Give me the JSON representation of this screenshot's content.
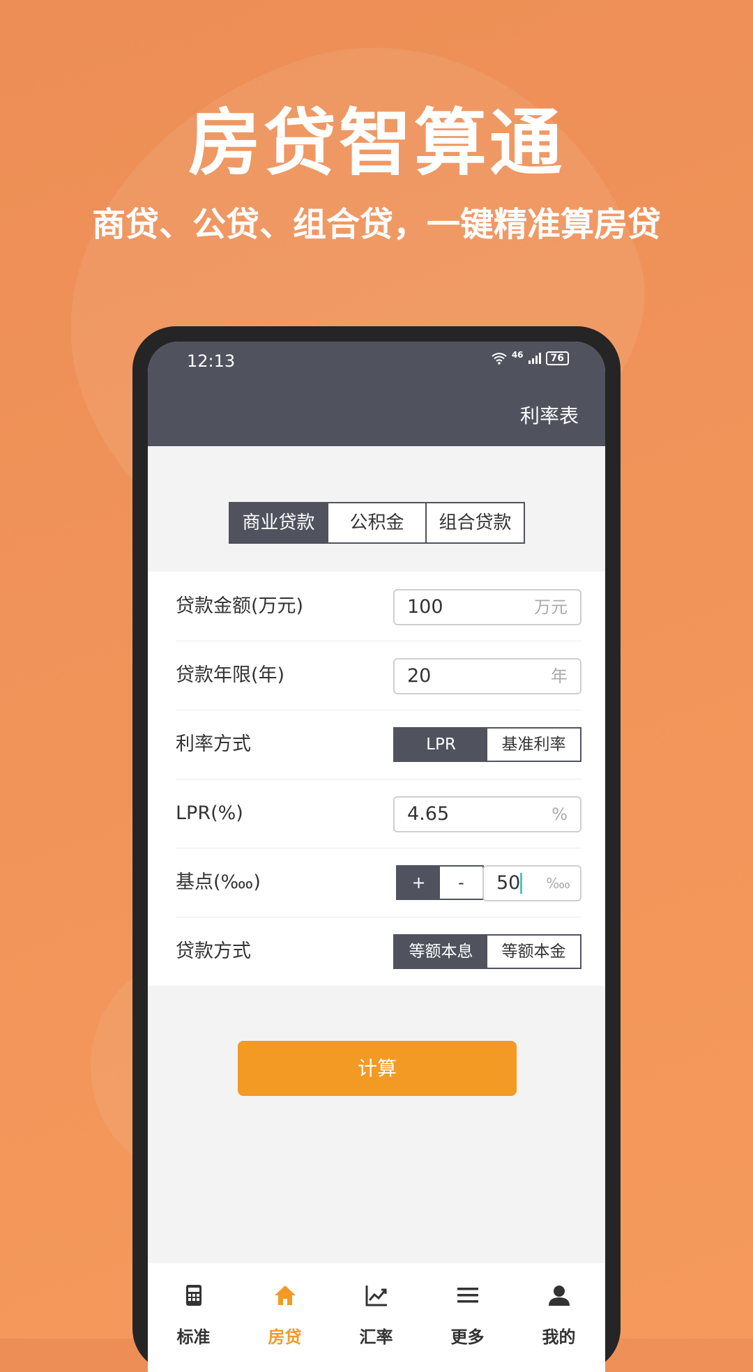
{
  "promo": {
    "title": "房贷智算通",
    "subtitle": "商贷、公贷、组合贷，一键精准算房贷"
  },
  "status_bar": {
    "time": "12:13",
    "network": "46",
    "battery": "76"
  },
  "app_bar": {
    "action_label": "利率表"
  },
  "loan_type_tabs": [
    {
      "label": "商业贷款",
      "active": true
    },
    {
      "label": "公积金",
      "active": false
    },
    {
      "label": "组合贷款",
      "active": false
    }
  ],
  "form": {
    "amount": {
      "label": "贷款金额(万元)",
      "value": "100",
      "unit": "万元"
    },
    "term": {
      "label": "贷款年限(年)",
      "value": "20",
      "unit": "年"
    },
    "rate_mode": {
      "label": "利率方式",
      "options": [
        "LPR",
        "基准利率"
      ],
      "selected": "LPR"
    },
    "lpr": {
      "label": "LPR(%)",
      "value": "4.65",
      "unit": "%"
    },
    "basis_points": {
      "label": "基点(‱)",
      "plus": "+",
      "minus": "-",
      "value": "50",
      "unit": "‱"
    },
    "repayment": {
      "label": "贷款方式",
      "options": [
        "等额本息",
        "等额本金"
      ],
      "selected": "等额本息"
    }
  },
  "calculate_label": "计算",
  "tabbar": [
    {
      "label": "标准",
      "icon": "calculator-icon",
      "active": false
    },
    {
      "label": "房贷",
      "icon": "home-icon",
      "active": true
    },
    {
      "label": "汇率",
      "icon": "chart-line-icon",
      "active": false
    },
    {
      "label": "更多",
      "icon": "menu-icon",
      "active": false
    },
    {
      "label": "我的",
      "icon": "user-icon",
      "active": false
    }
  ],
  "colors": {
    "background": "#f0935a",
    "app_bar": "#50535e",
    "accent": "#f39a24"
  }
}
